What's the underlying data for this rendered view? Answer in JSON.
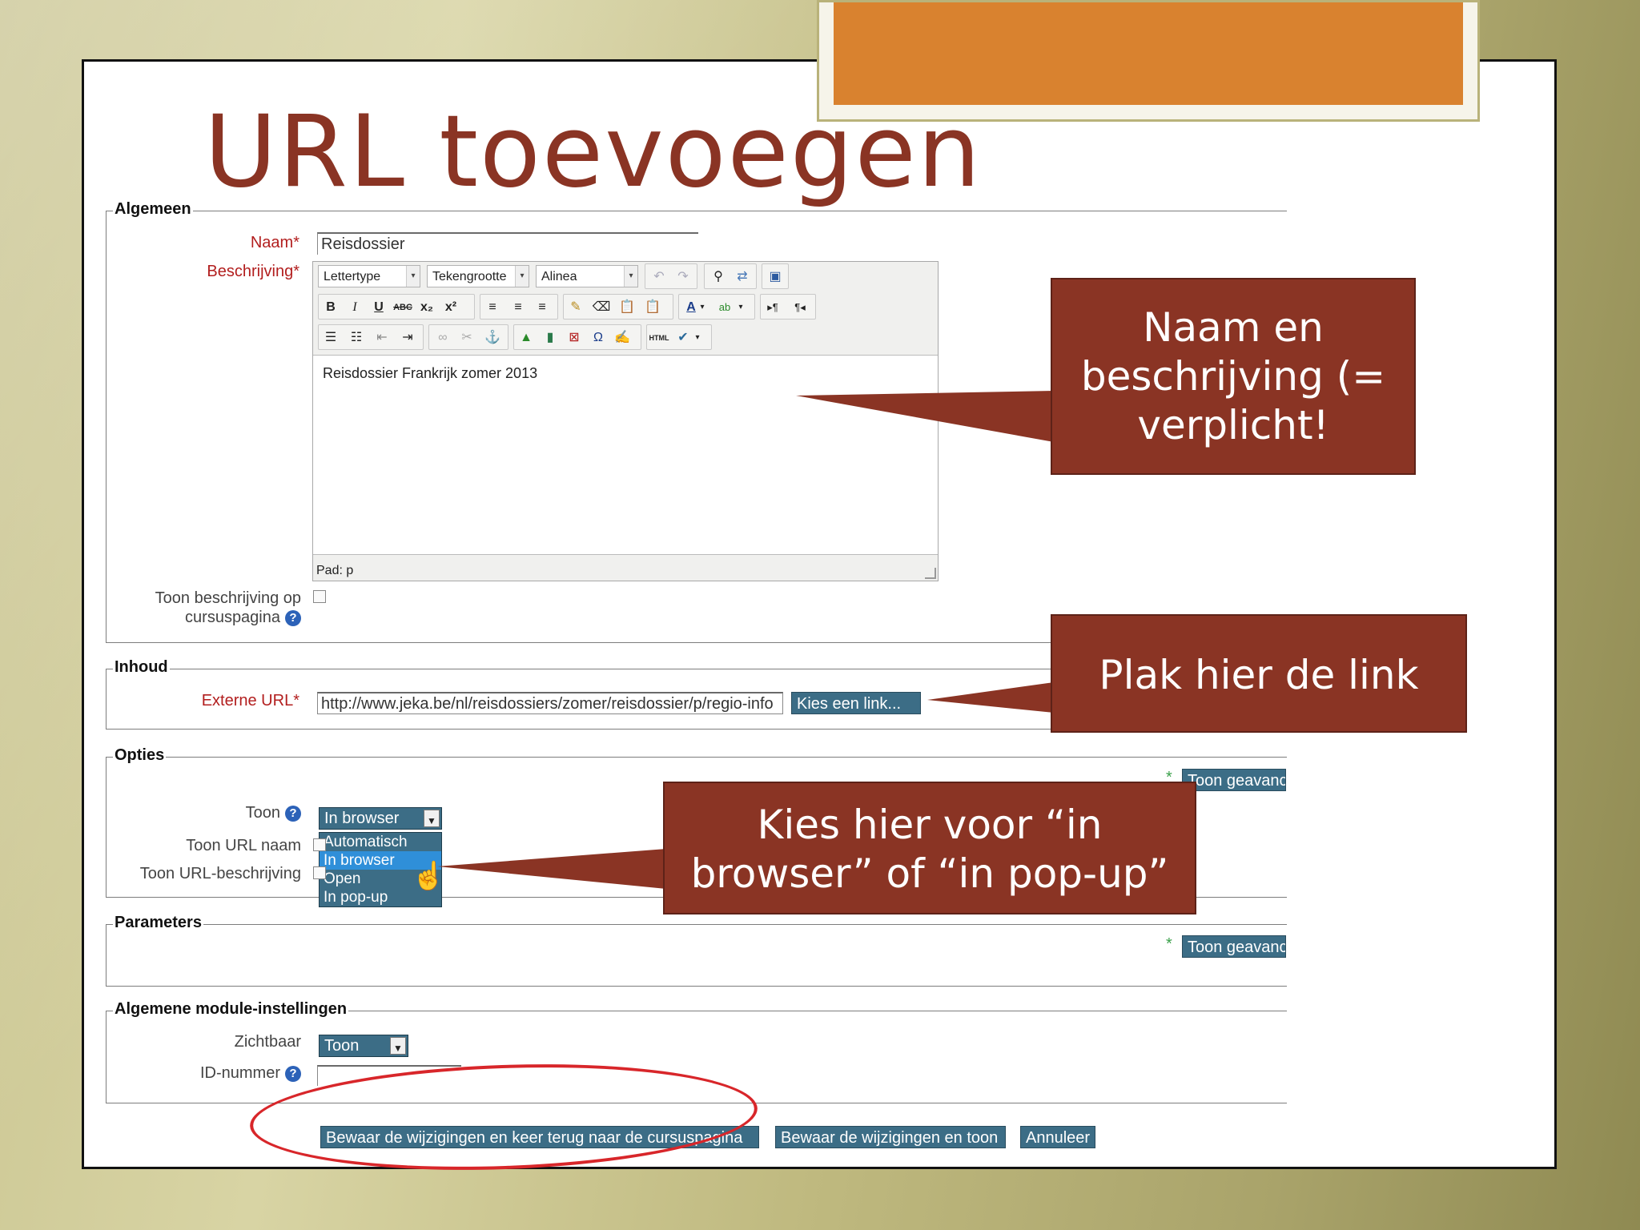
{
  "slide_title": "URL toevoegen",
  "sections": {
    "general": "Algemeen",
    "content": "Inhoud",
    "options": "Opties",
    "parameters": "Parameters",
    "module_settings": "Algemene module-instellingen"
  },
  "form": {
    "name_label": "Naam",
    "name_value": "Reisdossier",
    "description_label": "Beschrijving",
    "required_mark": "*",
    "show_desc_label_1": "Toon beschrijving op",
    "show_desc_label_2": "cursuspagina",
    "external_url_label": "Externe URL",
    "external_url_value": "http://www.jeka.be/nl/reisdossiers/zomer/reisdossier/p/regio-info",
    "choose_link_button": "Kies een link...",
    "show_advanced": "Toon geavanceerd",
    "display_label": "Toon",
    "display_selected": "In browser",
    "display_options": [
      "Automatisch",
      "In browser",
      "Open",
      "In pop-up"
    ],
    "show_url_name_label": "Toon URL naam",
    "show_url_desc_label": "Toon URL-beschrijving",
    "visible_label": "Zichtbaar",
    "visible_value": "Toon",
    "id_number_label": "ID-nummer",
    "help_glyph": "?"
  },
  "editor": {
    "font_select": "Lettertype",
    "size_select": "Tekengrootte",
    "format_select": "Alinea",
    "content": "Reisdossier Frankrijk zomer 2013",
    "path": "Pad: p"
  },
  "buttons": {
    "save_return": "Bewaar de wijzigingen en keer terug naar de cursuspagina",
    "save_display": "Bewaar de wijzigingen en toon",
    "cancel": "Annuleer"
  },
  "callouts": {
    "name_desc": [
      "Naam en",
      "beschrijving (=",
      "verplicht!"
    ],
    "paste_link": "Plak hier de link",
    "choose_display": [
      "Kies hier voor “in",
      "browser” of “in pop-up”"
    ]
  },
  "colors": {
    "title": "#8a3424",
    "callout": "#8a3424",
    "accent_orange": "#d9822f",
    "button": "#3c6d86",
    "required": "#b21e1e",
    "highlight_oval": "#d8262a"
  }
}
